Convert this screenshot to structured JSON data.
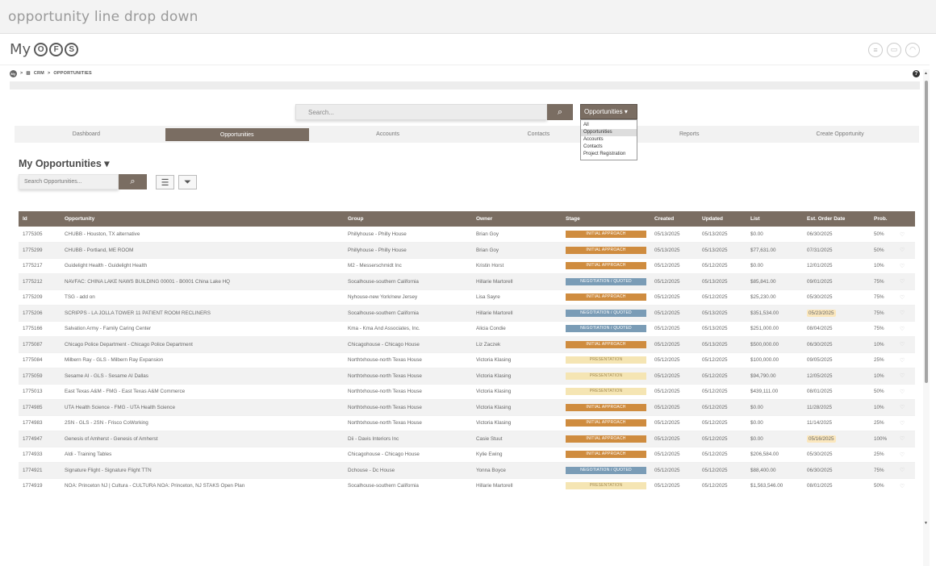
{
  "top_title": "opportunity line drop down",
  "header": {
    "logo_my": "My",
    "logo_letters": [
      "O",
      "F",
      "S"
    ]
  },
  "breadcrumb": {
    "home": "My",
    "crm": "CRM",
    "sep": ">",
    "current": "OPPORTUNITIES"
  },
  "search": {
    "placeholder": "Search...",
    "scope": "Opportunities"
  },
  "scope_options": [
    "All",
    "Opportunities",
    "Accounts",
    "Contacts",
    "Project Registration"
  ],
  "tabs": [
    "Dashboard",
    "Opportunities",
    "Accounts",
    "Contacts",
    "Reports",
    "Create Opportunity"
  ],
  "section_title": "My Opportunities",
  "opp_search_placeholder": "Search Opportunities...",
  "columns": [
    "Id",
    "Opportunity",
    "Group",
    "Owner",
    "Stage",
    "Created",
    "Updated",
    "List",
    "Est. Order Date",
    "Prob."
  ],
  "rows": [
    {
      "id": "1775305",
      "opp": "CHUBB - Houston, TX alternative",
      "group": "Phillyhouse - Philly House",
      "owner": "Brian Goy",
      "stage": "INITIAL APPROACH",
      "st": "ia",
      "created": "05/13/2025",
      "updated": "05/13/2025",
      "list": "$0.00",
      "est": "06/30/2025",
      "hl": false,
      "prob": "50%"
    },
    {
      "id": "1775299",
      "opp": "CHUBB - Portland, ME ROOM",
      "group": "Phillyhouse - Philly House",
      "owner": "Brian Goy",
      "stage": "INITIAL APPROACH",
      "st": "ia",
      "created": "05/13/2025",
      "updated": "05/13/2025",
      "list": "$77,631.00",
      "est": "07/31/2025",
      "hl": false,
      "prob": "50%"
    },
    {
      "id": "1775217",
      "opp": "Guidelight Health - Guidelight Health",
      "group": "M2 - Messerschmidt Inc",
      "owner": "Kristin Horst",
      "stage": "INITIAL APPROACH",
      "st": "ia",
      "created": "05/12/2025",
      "updated": "05/12/2025",
      "list": "$0.00",
      "est": "12/01/2025",
      "hl": false,
      "prob": "10%"
    },
    {
      "id": "1775212",
      "opp": "NAVFAC: CHINA LAKE NAWS BUILDING 00001 - B0001 China Lake HQ",
      "group": "Socalhouse-southern California",
      "owner": "Hillarie Martorell",
      "stage": "NEGOTIATION / QUOTED",
      "st": "nq",
      "created": "05/12/2025",
      "updated": "05/13/2025",
      "list": "$85,841.00",
      "est": "09/01/2025",
      "hl": false,
      "prob": "75%"
    },
    {
      "id": "1775209",
      "opp": "TSG - add on",
      "group": "Nyhouse-new York/new Jersey",
      "owner": "Lisa Sayre",
      "stage": "INITIAL APPROACH",
      "st": "ia",
      "created": "05/12/2025",
      "updated": "05/12/2025",
      "list": "$25,230.00",
      "est": "05/30/2025",
      "hl": false,
      "prob": "75%"
    },
    {
      "id": "1775206",
      "opp": "SCRIPPS - LA JOLLA TOWER 11 PATIENT ROOM RECLINERS",
      "group": "Socalhouse-southern California",
      "owner": "Hillarie Martorell",
      "stage": "NEGOTIATION / QUOTED",
      "st": "nq",
      "created": "05/12/2025",
      "updated": "05/13/2025",
      "list": "$351,534.00",
      "est": "05/23/2025",
      "hl": true,
      "prob": "75%"
    },
    {
      "id": "1775166",
      "opp": "Salvation Army - Family Caring Center",
      "group": "Kma - Kma And Associates, Inc.",
      "owner": "Alicia Condie",
      "stage": "NEGOTIATION / QUOTED",
      "st": "nq",
      "created": "05/12/2025",
      "updated": "05/13/2025",
      "list": "$251,000.00",
      "est": "08/04/2025",
      "hl": false,
      "prob": "75%"
    },
    {
      "id": "1775087",
      "opp": "Chicago Police Department - Chicago Police Department",
      "group": "Chicagohouse - Chicago House",
      "owner": "Liz Zaczek",
      "stage": "INITIAL APPROACH",
      "st": "ia",
      "created": "05/12/2025",
      "updated": "05/13/2025",
      "list": "$500,000.00",
      "est": "06/30/2025",
      "hl": false,
      "prob": "10%"
    },
    {
      "id": "1775084",
      "opp": "Milbern Ray - GLS - Milbern Ray Expansion",
      "group": "Northtxhouse-north Texas House",
      "owner": "Victoria Klasing",
      "stage": "PRESENTATION",
      "st": "pr",
      "created": "05/12/2025",
      "updated": "05/12/2025",
      "list": "$100,000.00",
      "est": "09/05/2025",
      "hl": false,
      "prob": "25%"
    },
    {
      "id": "1775059",
      "opp": "Sesame AI - GLS - Sesame AI Dallas",
      "group": "Northtxhouse-north Texas House",
      "owner": "Victoria Klasing",
      "stage": "PRESENTATION",
      "st": "pr",
      "created": "05/12/2025",
      "updated": "05/12/2025",
      "list": "$94,790.00",
      "est": "12/05/2025",
      "hl": false,
      "prob": "10%"
    },
    {
      "id": "1775013",
      "opp": "East Texas A&M - FMG - East Texas A&M Commerce",
      "group": "Northtxhouse-north Texas House",
      "owner": "Victoria Klasing",
      "stage": "PRESENTATION",
      "st": "pr",
      "created": "05/12/2025",
      "updated": "05/12/2025",
      "list": "$439,111.00",
      "est": "08/01/2025",
      "hl": false,
      "prob": "50%"
    },
    {
      "id": "1774985",
      "opp": "UTA Health Science - FMG - UTA Health Science",
      "group": "Northtxhouse-north Texas House",
      "owner": "Victoria Klasing",
      "stage": "INITIAL APPROACH",
      "st": "ia",
      "created": "05/12/2025",
      "updated": "05/12/2025",
      "list": "$0.00",
      "est": "11/28/2025",
      "hl": false,
      "prob": "10%"
    },
    {
      "id": "1774983",
      "opp": "2SN - GLS - 2SN - Frisco CoWorking",
      "group": "Northtxhouse-north Texas House",
      "owner": "Victoria Klasing",
      "stage": "INITIAL APPROACH",
      "st": "ia",
      "created": "05/12/2025",
      "updated": "05/12/2025",
      "list": "$0.00",
      "est": "11/14/2025",
      "hl": false,
      "prob": "25%"
    },
    {
      "id": "1774947",
      "opp": "Genesis of Amherst - Genesis of Amherst",
      "group": "Dii - Davis Interiors Inc",
      "owner": "Casie Stuut",
      "stage": "INITIAL APPROACH",
      "st": "ia",
      "created": "05/12/2025",
      "updated": "05/12/2025",
      "list": "$0.00",
      "est": "05/16/2025",
      "hl": true,
      "prob": "100%"
    },
    {
      "id": "1774933",
      "opp": "Aldi - Training Tables",
      "group": "Chicagohouse - Chicago House",
      "owner": "Kylie Ewing",
      "stage": "INITIAL APPROACH",
      "st": "ia",
      "created": "05/12/2025",
      "updated": "05/12/2025",
      "list": "$206,584.00",
      "est": "05/30/2025",
      "hl": false,
      "prob": "25%"
    },
    {
      "id": "1774921",
      "opp": "Signature Flight - Signature Flight TTN",
      "group": "Dchouse - Dc House",
      "owner": "Yonna Boyce",
      "stage": "NEGOTIATION / QUOTED",
      "st": "nq",
      "created": "05/12/2025",
      "updated": "05/12/2025",
      "list": "$88,400.00",
      "est": "06/30/2025",
      "hl": false,
      "prob": "75%"
    },
    {
      "id": "1774919",
      "opp": "NOA: Princeton NJ | Cultura - CULTURA NOA: Princeton, NJ STAKS Open Plan",
      "group": "Socalhouse-southern California",
      "owner": "Hillarie Martorell",
      "stage": "PRESENTATION",
      "st": "pr",
      "created": "05/12/2025",
      "updated": "05/12/2025",
      "list": "$1,563,546.00",
      "est": "08/01/2025",
      "hl": false,
      "prob": "50%"
    }
  ]
}
